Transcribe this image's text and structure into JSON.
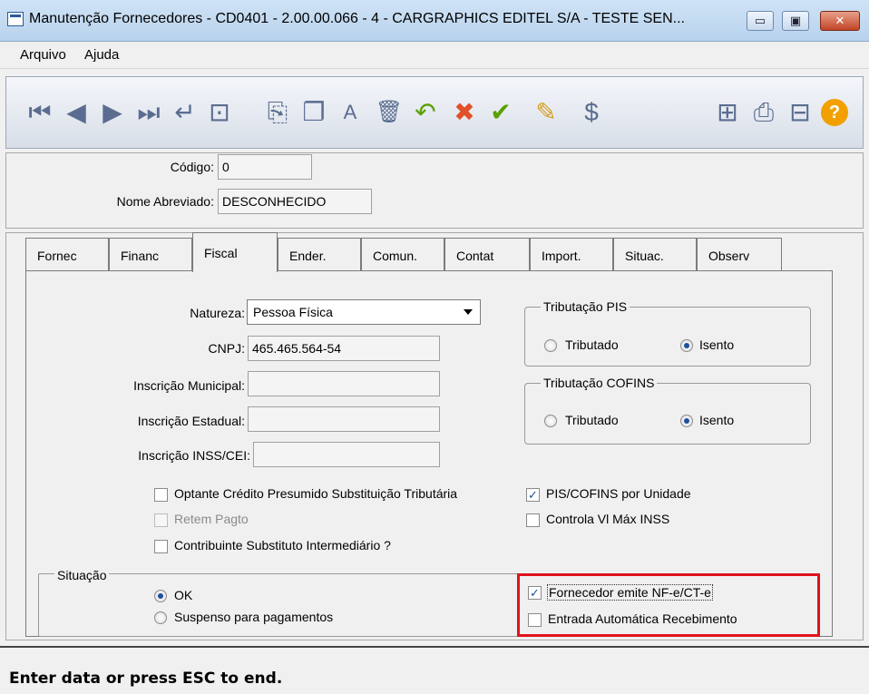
{
  "window": {
    "title": "Manutenção Fornecedores - CD0401 - 2.00.00.066 - 4 - CARGRAPHICS EDITEL S/A - TESTE SEN...",
    "minimize_glyph": "▭",
    "maximize_glyph": "▣",
    "close_glyph": "✕"
  },
  "menu": {
    "arquivo": "Arquivo",
    "ajuda": "Ajuda"
  },
  "toolbar": {
    "first": "⏮",
    "prev": "◀",
    "next": "▶",
    "last": "⏭",
    "goto": "↵",
    "search": "⊡",
    "copy": "⎘",
    "copy_record": "❐",
    "edit": "A",
    "delete": "🗑",
    "undo": "↶",
    "cancel": "✖",
    "ok": "✔",
    "pencil": "✎",
    "dollar": "$",
    "tree": "⊞",
    "print": "⎙",
    "exit": "⊟",
    "help": "?"
  },
  "header": {
    "codigo_label": "Código:",
    "codigo_value": "0",
    "nome_label": "Nome Abreviado:",
    "nome_value": "DESCONHECIDO"
  },
  "tabs": [
    "Fornec",
    "Financ",
    "Fiscal",
    "Ender.",
    "Comun.",
    "Contat",
    "Import.",
    "Situac.",
    "Observ"
  ],
  "fiscal": {
    "natureza_label": "Natureza:",
    "natureza_value": "Pessoa Física",
    "cnpj_label": "CNPJ:",
    "cnpj_value": "465.465.564-54",
    "insc_municipal_label": "Inscrição Municipal:",
    "insc_estadual_label": "Inscrição Estadual:",
    "insc_inss_label": "Inscrição INSS/CEI:",
    "trib_pis_title": "Tributação PIS",
    "trib_cofins_title": "Tributação COFINS",
    "tributado": "Tributado",
    "isento": "Isento",
    "optante_label": "Optante Crédito Presumido Substituição Tributária",
    "retem_label": "Retem Pagto",
    "contribuinte_label": "Contribuinte Substituto Intermediário ?",
    "pis_cofins_label": "PIS/COFINS por Unidade",
    "controla_label": "Controla Vl Máx INSS",
    "check_mark": "✓"
  },
  "situacao": {
    "title": "Situação",
    "ok": "OK",
    "suspenso": "Suspenso para pagamentos",
    "emite_nfe": "Fornecedor emite NF-e/CT-e",
    "entrada_auto": "Entrada Automática Recebimento"
  },
  "status": {
    "text": "Enter data or press ESC to end."
  }
}
